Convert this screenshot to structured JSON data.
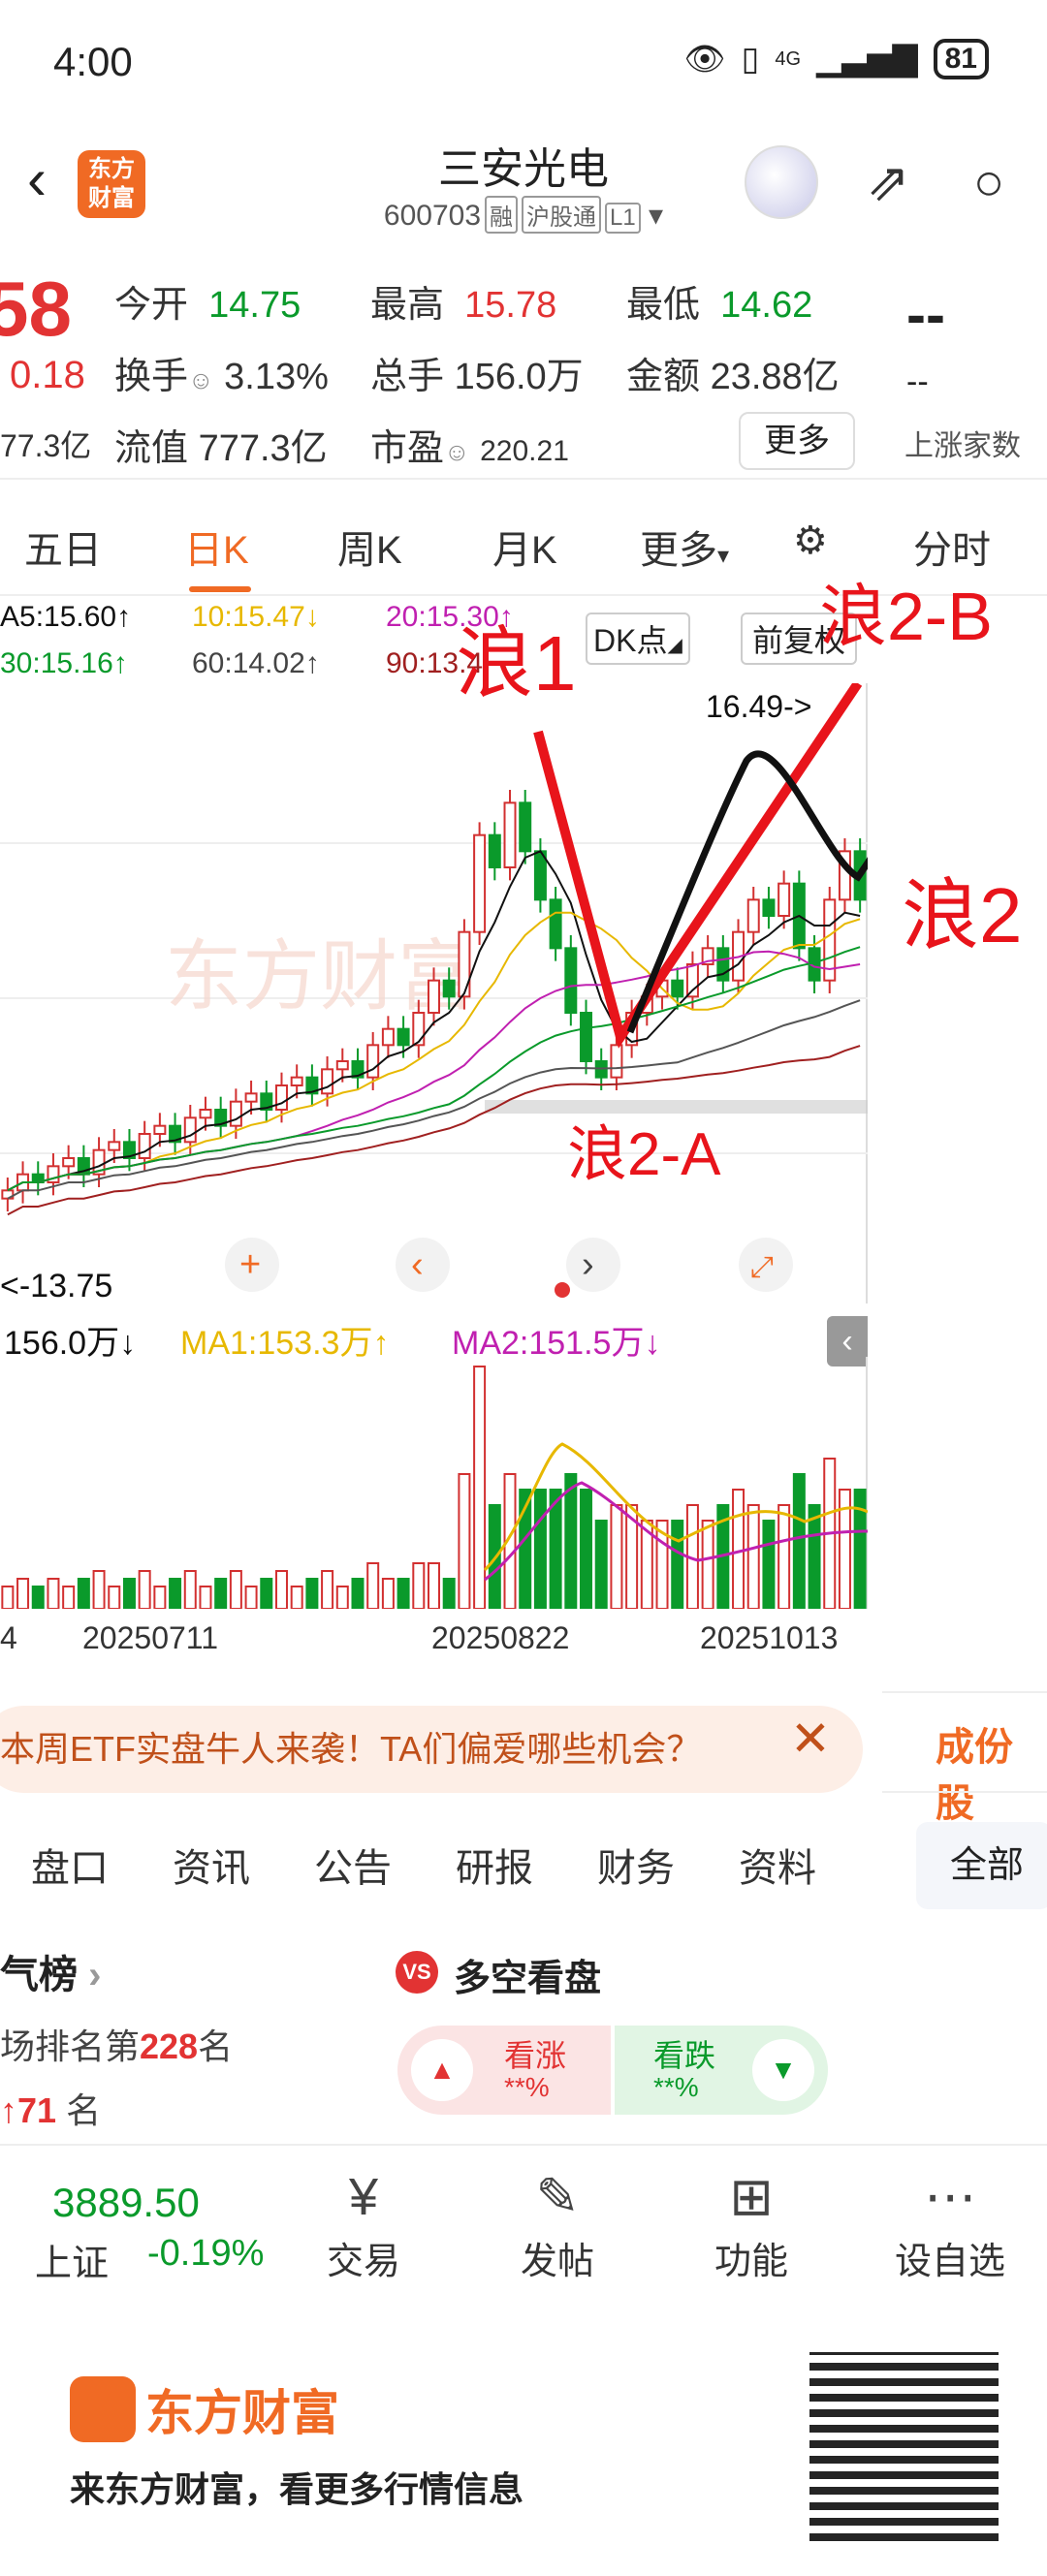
{
  "status": {
    "time": "4:00",
    "network": "4G",
    "battery": "81"
  },
  "header": {
    "name": "三安光电",
    "code": "600703",
    "tags": [
      "融",
      "沪股通",
      "L1"
    ],
    "logo_line1": "东方",
    "logo_line2": "财富"
  },
  "quote": {
    "price": "58",
    "change": "0.18",
    "mktcap_left": "77.3亿",
    "rows": [
      [
        {
          "label": "今开",
          "value": "14.75",
          "color": "green"
        },
        {
          "label": "最高",
          "value": "15.78",
          "color": "red"
        },
        {
          "label": "最低",
          "value": "14.62",
          "color": "green"
        }
      ],
      [
        {
          "label": "换手",
          "value": "3.13%"
        },
        {
          "label": "总手",
          "value": "156.0万"
        },
        {
          "label": "金额",
          "value": "23.88亿"
        }
      ],
      [
        {
          "label": "流值",
          "value": "777.3亿"
        },
        {
          "label": "市盈",
          "value": "220.21"
        }
      ]
    ],
    "more": "更多",
    "dashes": "--",
    "dash2": "--",
    "up_count_label": "上涨家数"
  },
  "tabs": [
    "五日",
    "日K",
    "周K",
    "月K",
    "更多",
    "分时"
  ],
  "active_tab": "日K",
  "ma": {
    "ma5": "A5:15.60↑",
    "ma10": "10:15.47↓",
    "ma20": "20:15.30↑",
    "ma30": "30:15.16↑",
    "ma60": "60:14.02↑",
    "ma90": "90:13.4"
  },
  "chart_ctrl": {
    "dk": "DK点",
    "fq": "前复权"
  },
  "chart_labels": {
    "high": "16.49->",
    "low": "<-13.75"
  },
  "annotations": {
    "w1": "浪1",
    "w2b": "浪2-B",
    "w2": "浪2",
    "w2a": "浪2-A"
  },
  "volume_legend": {
    "vol": "156.0万↓",
    "ma1": "MA1:153.3万↑",
    "ma2": "MA2:151.5万↓"
  },
  "x_labels": [
    "4",
    "20250711",
    "20250822",
    "20251013"
  ],
  "banner": {
    "text": "本周ETF实盘牛人来袭！TA们偏爱哪些机会？"
  },
  "side": {
    "tab": "成份股",
    "all": "全部"
  },
  "subtabs": [
    "盘口",
    "资讯",
    "公告",
    "研报",
    "财务",
    "资料"
  ],
  "popularity": {
    "title": "气榜",
    "rank_prefix": "场排名第",
    "rank": "228",
    "rank_suffix": "名",
    "up": "71",
    "up_suffix": "名"
  },
  "duokong": {
    "vs": "VS",
    "title": "多空看盘",
    "bull": "看涨",
    "bull_val": "**%",
    "bear": "看跌",
    "bear_val": "**%"
  },
  "index": {
    "value": "3889.50",
    "name": "上证",
    "change": "-0.19%"
  },
  "nav": [
    {
      "label": "交易",
      "icon": "¥"
    },
    {
      "label": "发帖",
      "icon": "✎"
    },
    {
      "label": "功能",
      "icon": "⊞"
    },
    {
      "label": "设自选",
      "icon": "⋯"
    }
  ],
  "footer": {
    "brand": "东方财富",
    "slogan": "来东方财富，看更多行情信息"
  },
  "chart_data": {
    "type": "candlestick",
    "high_label": 16.49,
    "low_label": 13.75,
    "closes": [
      13.8,
      13.9,
      13.85,
      13.95,
      14.0,
      13.9,
      14.05,
      14.1,
      14.0,
      14.15,
      14.2,
      14.1,
      14.25,
      14.3,
      14.2,
      14.35,
      14.4,
      14.3,
      14.45,
      14.5,
      14.4,
      14.55,
      14.6,
      14.5,
      14.7,
      14.8,
      14.7,
      14.9,
      15.1,
      15.0,
      15.4,
      16.0,
      15.8,
      16.2,
      15.9,
      15.6,
      15.3,
      14.9,
      14.6,
      14.5,
      14.7,
      14.9,
      15.0,
      15.1,
      15.0,
      15.2,
      15.3,
      15.1,
      15.4,
      15.6,
      15.5,
      15.7,
      15.3,
      15.1,
      15.6,
      15.9,
      15.6
    ]
  }
}
